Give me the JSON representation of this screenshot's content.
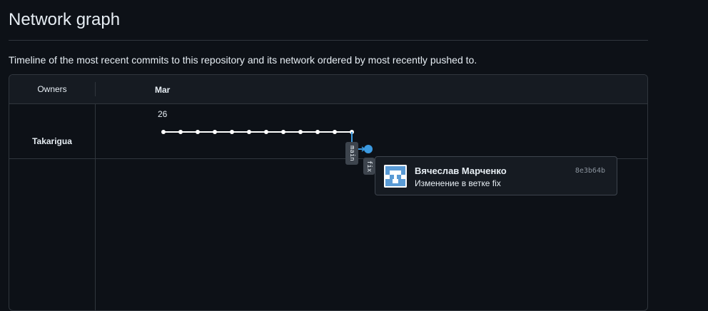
{
  "page": {
    "title": "Network graph",
    "description": "Timeline of the most recent commits to this repository and its network ordered by most recently pushed to."
  },
  "graph": {
    "owners_label": "Owners",
    "month": "Mar",
    "day": "26",
    "owners": [
      {
        "name": "Takarigua"
      }
    ],
    "branches": [
      {
        "label": "main"
      },
      {
        "label": "fix"
      }
    ],
    "main_commit_count": 12,
    "branch_color": "#ffffff",
    "fix_color": "#3b9ae1"
  },
  "tooltip": {
    "author": "Вячеслав Марченко",
    "sha": "8e3b64b",
    "message": "Изменение в ветке fix",
    "avatar_colors": [
      "#5a9bd5",
      "#ffffff"
    ]
  },
  "colors": {
    "background": "#0d1117",
    "panel": "#161b22",
    "border": "#30363d",
    "text": "#e6edf3",
    "muted": "#8b949e"
  }
}
